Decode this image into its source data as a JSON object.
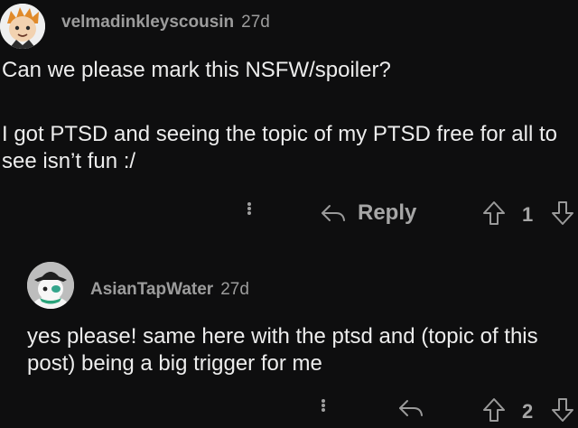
{
  "comments": [
    {
      "username": "velmadinkleyscousin",
      "age": "27d",
      "paragraphs": [
        "Can we please mark this NSFW/spoiler?",
        "I got PTSD and seeing the topic of my PTSD free for all to see isn’t fun :/"
      ],
      "reply_label": "Reply",
      "vote_count": "1"
    },
    {
      "username": "AsianTapWater",
      "age": "27d",
      "paragraphs": [
        "yes please! same here with the ptsd and (topic of this post) being a big trigger for me"
      ],
      "vote_count": "2"
    }
  ],
  "icons": {
    "more": "more-options-icon",
    "reply": "reply-arrow-icon",
    "upvote": "upvote-arrow-icon",
    "downvote": "downvote-arrow-icon"
  },
  "colors": {
    "background": "#0e0e0f",
    "meta_text": "#9c9c9c",
    "body_text": "#ededed",
    "icon": "#9a9a9a"
  }
}
